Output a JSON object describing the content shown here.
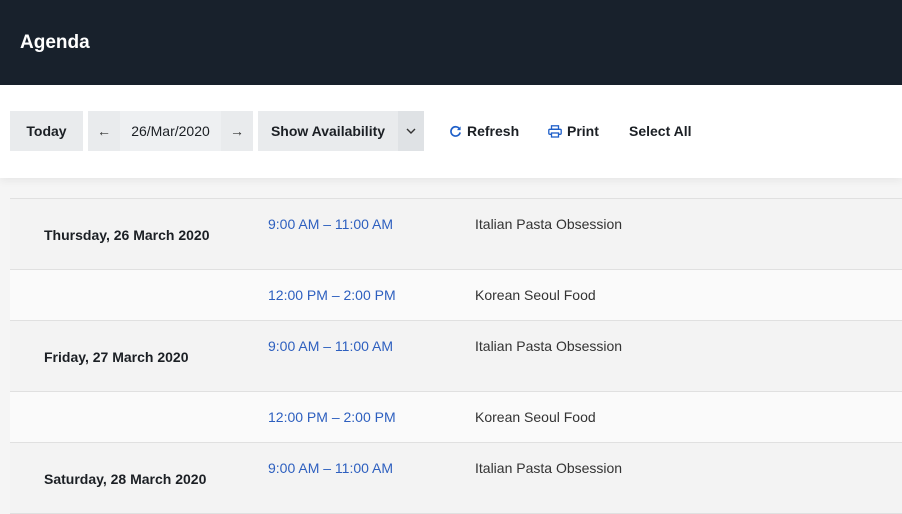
{
  "app": {
    "title": "Agenda"
  },
  "toolbar": {
    "today_label": "Today",
    "current_date": "26/Mar/2020",
    "show_availability_label": "Show Availability",
    "refresh_label": "Refresh",
    "print_label": "Print",
    "select_all_label": "Select All"
  },
  "agenda": {
    "days": [
      {
        "date": "Thursday, 26 March 2020",
        "events": [
          {
            "time": "9:00 AM – 11:00 AM",
            "title": "Italian Pasta Obsession"
          },
          {
            "time": "12:00 PM – 2:00 PM",
            "title": "Korean Seoul Food"
          }
        ]
      },
      {
        "date": "Friday, 27 March 2020",
        "events": [
          {
            "time": "9:00 AM – 11:00 AM",
            "title": "Italian Pasta Obsession"
          },
          {
            "time": "12:00 PM – 2:00 PM",
            "title": "Korean Seoul Food"
          }
        ]
      },
      {
        "date": "Saturday, 28 March 2020",
        "events": [
          {
            "time": "9:00 AM – 11:00 AM",
            "title": "Italian Pasta Obsession"
          }
        ]
      }
    ]
  },
  "colors": {
    "header_bg": "#18212c",
    "time_link": "#2d5fbf",
    "icon_blue": "#1e5fc9"
  },
  "icons": [
    "arrow-left-icon",
    "arrow-right-icon",
    "chevron-down-icon",
    "refresh-icon",
    "printer-icon"
  ]
}
